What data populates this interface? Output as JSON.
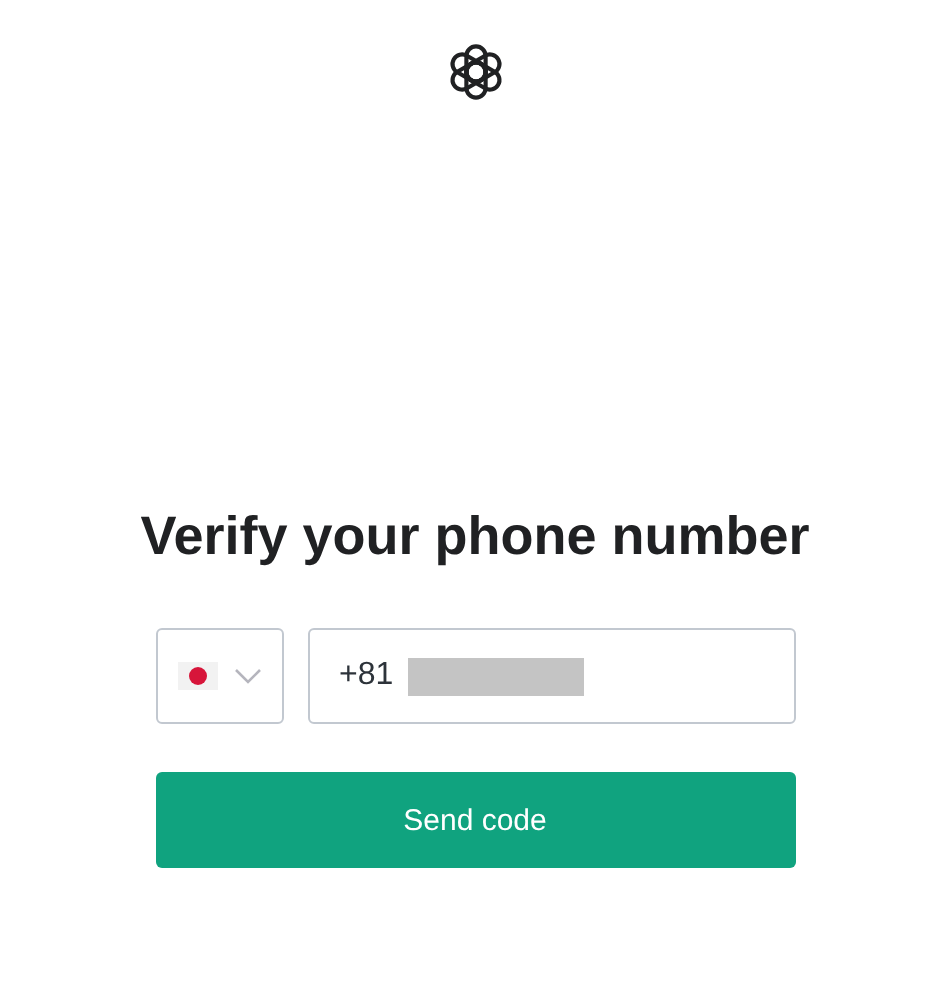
{
  "heading": "Verify your phone number",
  "phone_field": {
    "value": "+81"
  },
  "button": "Send code"
}
